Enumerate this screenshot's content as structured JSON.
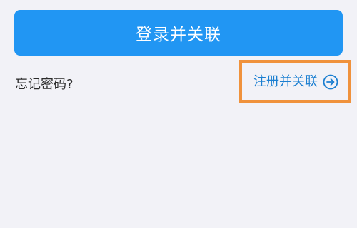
{
  "login": {
    "button_label": "登录并关联"
  },
  "links": {
    "forgot_password": "忘记密码?",
    "register": "注册并关联"
  },
  "icons": {
    "register_arrow": "arrow-right-circle-icon"
  },
  "colors": {
    "primary": "#2196f3",
    "link": "#1b7fd1",
    "highlight": "#f0923c",
    "background": "#f2f2f7"
  }
}
